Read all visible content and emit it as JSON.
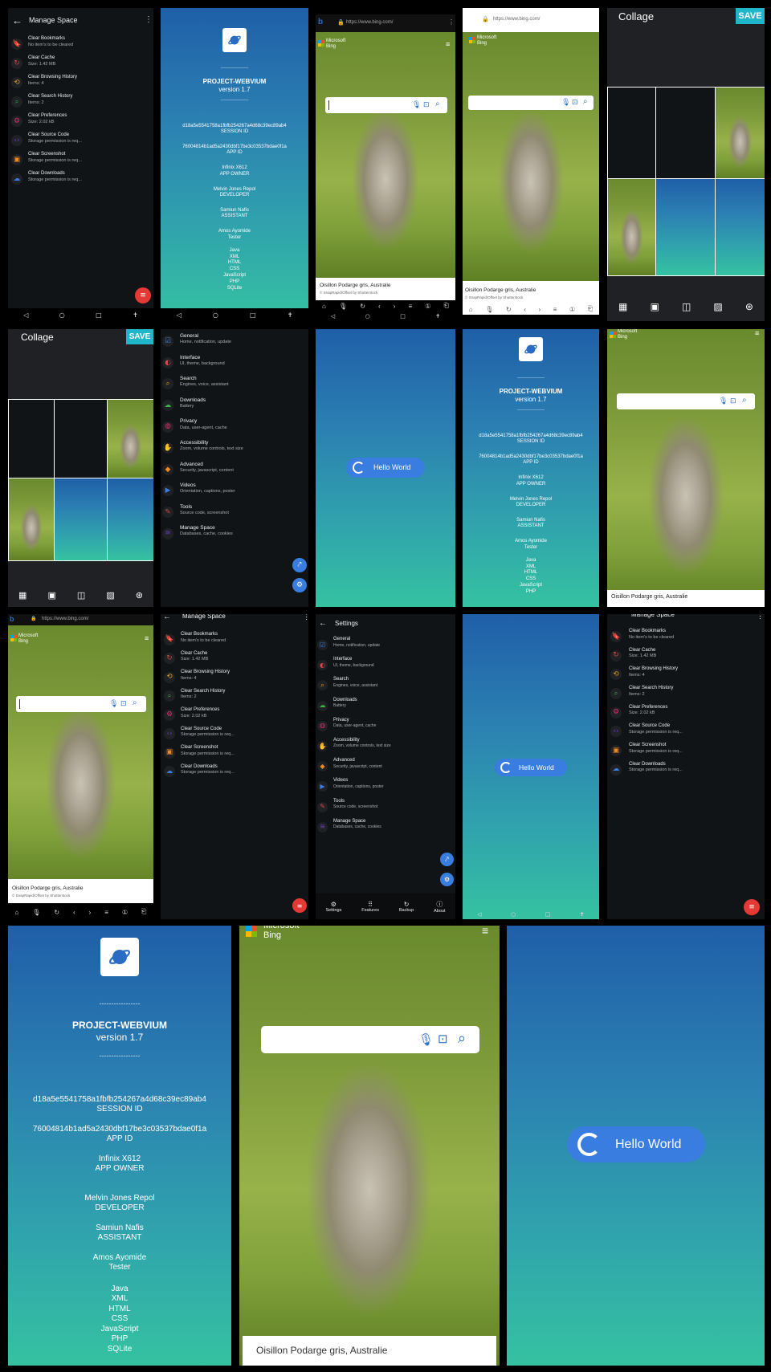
{
  "manage_space": {
    "title": "Manage Space",
    "items": [
      {
        "title": "Clear Bookmarks",
        "sub": "No item's to be cleared",
        "icon": "bookmark-icon",
        "color": "#4a7fe0"
      },
      {
        "title": "Clear Cache",
        "sub": "Size: 1.42 MB",
        "icon": "refresh-icon",
        "color": "#e0474a"
      },
      {
        "title": "Clear Browsing History",
        "sub": "Items: 4",
        "icon": "history-icon",
        "color": "#e0a020"
      },
      {
        "title": "Clear Search History",
        "sub": "Items: 2",
        "icon": "search-icon",
        "color": "#39b34a"
      },
      {
        "title": "Clear Preferences",
        "sub": "Size: 2.02 kB",
        "icon": "gear-icon",
        "color": "#e0306a"
      },
      {
        "title": "Clear Source Code",
        "sub": "Storage permission is req...",
        "icon": "code-icon",
        "color": "#6a3ec0"
      },
      {
        "title": "Clear Screenshot",
        "sub": "Storage permission is req...",
        "icon": "image-icon",
        "color": "#f08a20"
      },
      {
        "title": "Clear Downloads",
        "sub": "Storage permission is req...",
        "icon": "cloud-download-icon",
        "color": "#3a7de0"
      }
    ]
  },
  "about": {
    "divider": "-----------------",
    "project": "PROJECT-WEBVIUM",
    "version": "version 1.7",
    "session_id": "d18a5e5541758a1fbfb254267a4d68c39ec89ab4",
    "session_label": "SESSION ID",
    "app_id": "76004814b1ad5a2430dbf17be3c03537bdae0f1a",
    "app_label": "APP ID",
    "owner": "Infinix X612",
    "owner_label": "APP OWNER",
    "developer": "Melvin Jones Repol",
    "developer_label": "DEVELOPER",
    "assistant": "Samiun Nafis",
    "assistant_label": "ASSISTANT",
    "tester": "Amos Ayomide",
    "tester_label": "Tester",
    "langs": [
      "Java",
      "XML",
      "HTML",
      "CSS",
      "JavaScript",
      "PHP",
      "SQLite"
    ]
  },
  "bing": {
    "url": "https://www.bing.com/",
    "brand_line1": "Microsoft",
    "brand_line2": "Bing",
    "caption": "Oisillon Podarge gris, Australie",
    "credit": "© SnapRapid/Offset by Shutterstock"
  },
  "collage": {
    "title": "Collage",
    "save": "SAVE"
  },
  "settings": {
    "title": "Settings",
    "items": [
      {
        "title": "General",
        "sub": "Home, notification, update",
        "icon": "checkbox-icon",
        "color": "#3a7de0"
      },
      {
        "title": "Interface",
        "sub": "UI, theme, background",
        "icon": "palette-icon",
        "color": "#e0474a"
      },
      {
        "title": "Search",
        "sub": "Engines, voice, assistant",
        "icon": "search-icon",
        "color": "#e0a020"
      },
      {
        "title": "Downloads",
        "sub": "Battery",
        "icon": "cloud-icon",
        "color": "#39b34a"
      },
      {
        "title": "Privacy",
        "sub": "Data, user-agent, cache",
        "icon": "privacy-icon",
        "color": "#e0306a"
      },
      {
        "title": "Accessibility",
        "sub": "Zoom, volume controls, text size",
        "icon": "accessibility-icon",
        "color": "#6a3ec0"
      },
      {
        "title": "Advanced",
        "sub": "Security, javascript, content",
        "icon": "advanced-icon",
        "color": "#f08a20"
      },
      {
        "title": "Videos",
        "sub": "Orientation, captions, poster",
        "icon": "video-icon",
        "color": "#3a7de0"
      },
      {
        "title": "Tools",
        "sub": "Source code, screenshot",
        "icon": "tools-icon",
        "color": "#e0474a"
      },
      {
        "title": "Manage Space",
        "sub": "Databases, cache, cookies",
        "icon": "storage-icon",
        "color": "#6a3ec0"
      }
    ],
    "bottom_nav": [
      "Settings",
      "Features",
      "Backup",
      "About"
    ]
  },
  "hello": {
    "label": "Hello World"
  },
  "colors": {
    "accent_blue": "#3a7de0",
    "fab_red": "#e53935",
    "save_teal": "#1fb6c9"
  }
}
